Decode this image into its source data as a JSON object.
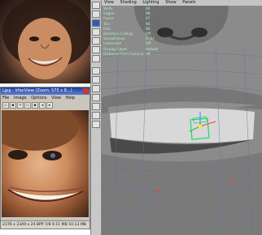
{
  "viewer": {
    "title": "Ljpg - IrfanView (Zoom: 575 x 8...)",
    "menu": [
      "File",
      "Image",
      "Options",
      "View",
      "Help"
    ],
    "toolbar_icons": [
      "open-icon",
      "save-icon",
      "delete-icon",
      "copy-icon",
      "paste-icon",
      "prev-icon",
      "next-icon"
    ],
    "status": "2376 x 2349 x 24 BPP   7/8   9.11 MB   10.13 MB"
  },
  "toolbox": {
    "tools": [
      "select-tool-icon",
      "lasso-tool-icon",
      "move-tool-icon",
      "rotate-tool-icon",
      "scale-tool-icon",
      "manip-tool-icon",
      "last-tool-icon",
      "layout-single-icon",
      "layout-four-icon",
      "layout-persp-icon",
      "layout-outliner-icon",
      "layout-graph-icon",
      "layout-hypershade-icon",
      "layout-script-icon"
    ]
  },
  "viewport": {
    "menu": [
      "View",
      "Shading",
      "Lighting",
      "Show",
      "Panels"
    ],
    "hud": [
      {
        "label": "Verts:",
        "value": "66"
      },
      {
        "label": "Edges:",
        "value": "98"
      },
      {
        "label": "Faces:",
        "value": "97"
      },
      {
        "label": "Tris:",
        "value": "96"
      },
      {
        "label": "UVs:",
        "value": "96"
      },
      {
        "label": "Backface Culling:",
        "value": "Off"
      },
      {
        "label": "Smoothness:",
        "value": "0 (3)"
      },
      {
        "label": "Instanced:",
        "value": "Off"
      },
      {
        "label": "Display Layer:",
        "value": "default"
      },
      {
        "label": "Distance From Camera:",
        "value": "off"
      }
    ],
    "colors": {
      "hud_text": "#b7f0c5",
      "selection": "#29d36b",
      "axis_x": "#ff3b30",
      "axis_y": "#2a8dff",
      "axis_z": "#1fbf3f"
    }
  }
}
